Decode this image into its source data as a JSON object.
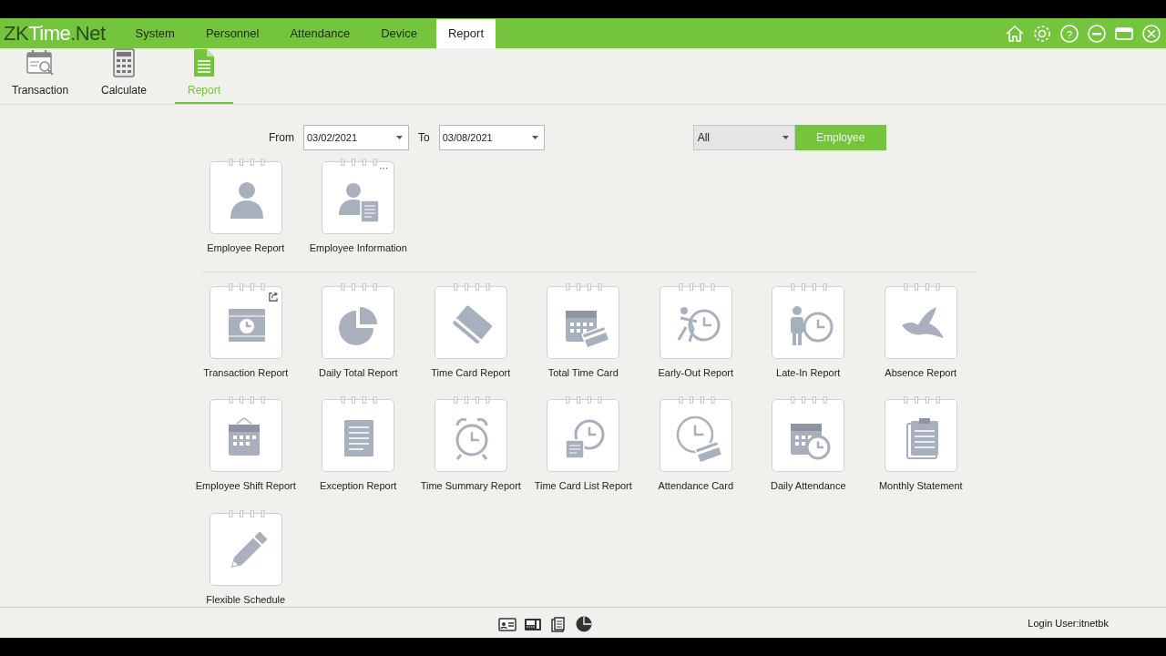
{
  "app": {
    "logo_main": "ZKTime",
    "logo_suffix": ".Net"
  },
  "menu": [
    {
      "label": "System",
      "selected": false
    },
    {
      "label": "Personnel",
      "selected": false
    },
    {
      "label": "Attendance",
      "selected": false
    },
    {
      "label": "Device",
      "selected": false
    },
    {
      "label": "Report",
      "selected": true
    }
  ],
  "toolbar": [
    {
      "label": "Transaction",
      "kind": "transaction",
      "selected": false
    },
    {
      "label": "Calculate",
      "kind": "calculator",
      "selected": false
    },
    {
      "label": "Report",
      "kind": "report",
      "selected": true
    }
  ],
  "filters": {
    "from_label": "From",
    "from_value": "03/02/2021",
    "to_label": "To",
    "to_value": "03/08/2021",
    "scope_value": "All",
    "scope_button": "Employee"
  },
  "groups": [
    {
      "reports": [
        {
          "label": "Employee Report",
          "kind": "person"
        },
        {
          "label": "Employee Information",
          "kind": "person-doc",
          "corner": "···"
        }
      ]
    },
    {
      "reports": [
        {
          "label": "Transaction Report",
          "kind": "doc-clock",
          "export_mark": true
        },
        {
          "label": "Daily Total Report",
          "kind": "pie"
        },
        {
          "label": "Time Card Report",
          "kind": "card"
        },
        {
          "label": "Total Time Card",
          "kind": "calendar-card"
        },
        {
          "label": "Early-Out Report",
          "kind": "runner-clock"
        },
        {
          "label": "Late-In Report",
          "kind": "person-clock"
        },
        {
          "label": "Absence Report",
          "kind": "bird"
        },
        {
          "label": "Employee Shift Report",
          "kind": "calendar"
        },
        {
          "label": "Exception Report",
          "kind": "doc"
        },
        {
          "label": "Time Summary Report",
          "kind": "alarm"
        },
        {
          "label": "Time Card List Report",
          "kind": "doc-clock-side"
        },
        {
          "label": "Attendance Card",
          "kind": "clock-card"
        },
        {
          "label": "Daily Attendance",
          "kind": "calendar-clock"
        },
        {
          "label": "Monthly Statement",
          "kind": "clipboard"
        },
        {
          "label": "Flexible Schedule",
          "kind": "pencil"
        }
      ]
    }
  ],
  "window_controls": {
    "help_glyph": "?"
  },
  "status_bar": {
    "login": "Login User:itnetbk"
  }
}
